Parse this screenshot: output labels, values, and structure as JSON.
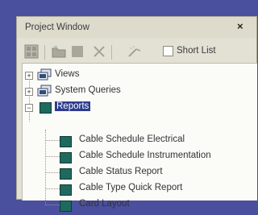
{
  "window": {
    "title": "Project Window",
    "close_glyph": "×"
  },
  "toolbar": {
    "icons": [
      "grid-icon",
      "folder-icon",
      "stop-icon",
      "delete-x-icon",
      "wand-icon"
    ],
    "short_list_label": "Short List",
    "short_list_checked": false
  },
  "tree": {
    "nodes": [
      {
        "label": "Views",
        "expander": "+",
        "icon": "folder-stack-icon"
      },
      {
        "label": "System Queries",
        "expander": "+",
        "icon": "folder-stack-icon"
      },
      {
        "label": "Reports",
        "expander": "−",
        "icon": "report-icon",
        "selected": true
      }
    ],
    "reports": [
      "Cable Schedule Electrical",
      "Cable Schedule Instrumentation",
      "Cable Status Report",
      "Cable Type Quick Report",
      "Card Layout"
    ]
  },
  "colors": {
    "background": "#4a4f9e",
    "selection": "#2d3b8e",
    "report_icon": "#1e6a5e"
  }
}
